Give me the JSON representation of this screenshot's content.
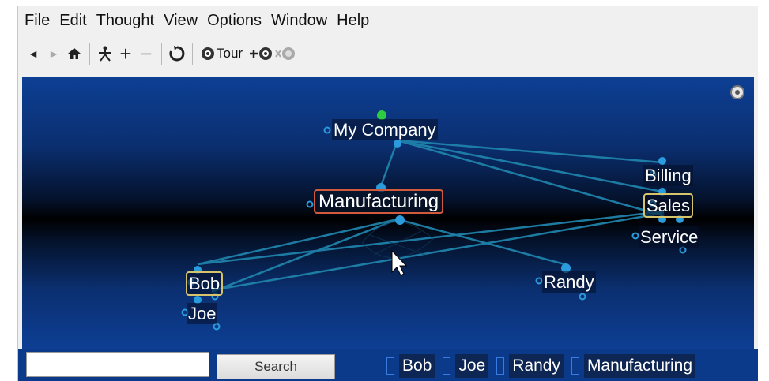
{
  "menu": [
    "File",
    "Edit",
    "Thought",
    "View",
    "Options",
    "Window",
    "Help"
  ],
  "toolbar": {
    "back_icon": "◄",
    "forward_icon": "►",
    "home_icon": "home-icon",
    "tour_label": "Tour",
    "add_icon": "+",
    "remove_icon": "−"
  },
  "brain": {
    "thoughts": {
      "my_company": "My Company",
      "manufacturing": "Manufacturing",
      "billing": "Billing",
      "sales": "Sales",
      "service": "Service",
      "bob": "Bob",
      "joe": "Joe",
      "randy": "Randy"
    },
    "link_color": "#2a8fb8",
    "node_color": "#2a9bdc",
    "active_border": "#d25a3c",
    "pinned_border": "#d6c46a"
  },
  "search": {
    "value": "",
    "placeholder": "",
    "button_label": "Search"
  },
  "pins": [
    "Bob",
    "Joe",
    "Randy",
    "Manufacturing"
  ]
}
